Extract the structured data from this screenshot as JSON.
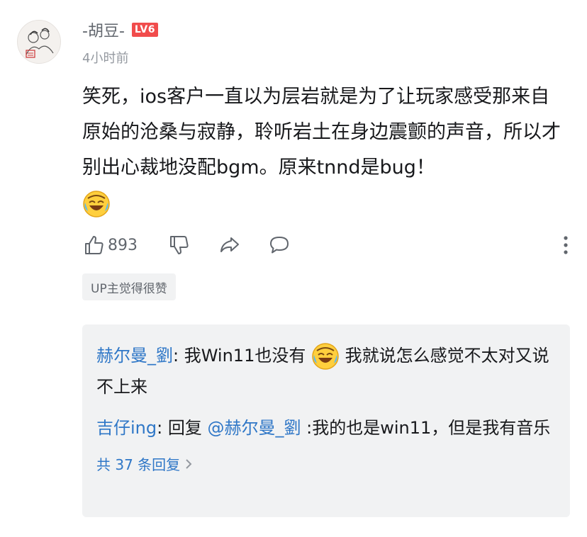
{
  "comment": {
    "username": "-胡豆-",
    "level": "LV6",
    "timestamp": "4小时前",
    "text_1": "笑死，ios客户一直以为层岩就是为了让玩家感受那来自原始的沧桑与寂静，聆听岩土在身边震颤的声音，所以才别出心裁地没配bgm。原来tnnd是bug！",
    "emoji": "laughing-crying-emoji",
    "like_count": "893",
    "up_badge": "UP主觉得很赞"
  },
  "replies": [
    {
      "user": "赫尔曼_劉",
      "sep": ": ",
      "text_1": "我Win11也没有",
      "emoji": "laughing-crying-emoji",
      "text_2": "我就说怎么感觉不太对又说不上来"
    },
    {
      "user": "吉仔ing",
      "sep": ": ",
      "prefix": "回复 ",
      "mention": "@赫尔曼_劉",
      "text": " :我的也是win11，但是我有音乐"
    }
  ],
  "replies_more": "共 37 条回复",
  "colors": {
    "link": "#2f77c7",
    "level_badge": "#f14c4c",
    "panel": "#f1f2f3",
    "muted": "#9499a0"
  }
}
